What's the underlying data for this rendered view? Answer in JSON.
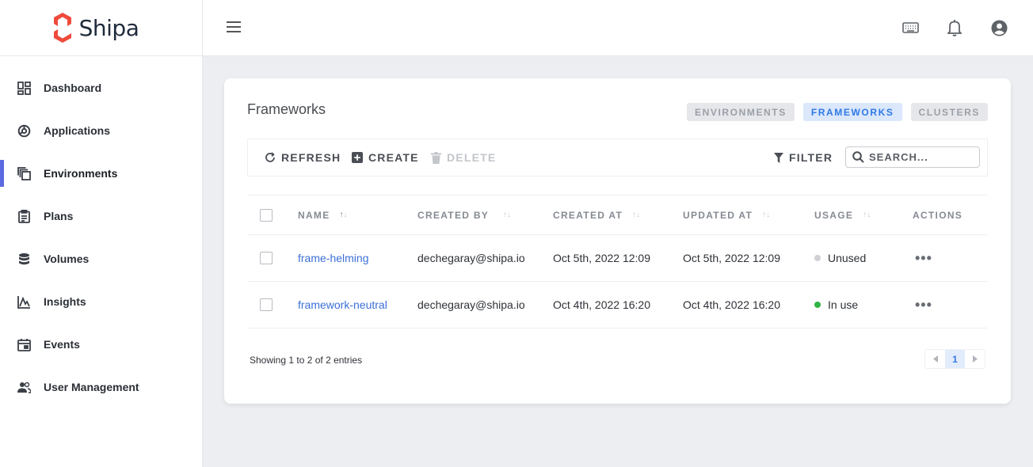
{
  "brand": {
    "name": "Shipa",
    "color": "#ef4a3c"
  },
  "sidebar": {
    "items": [
      {
        "label": "Dashboard",
        "icon": "dashboard-icon"
      },
      {
        "label": "Applications",
        "icon": "applications-icon"
      },
      {
        "label": "Environments",
        "icon": "environments-icon",
        "active": true
      },
      {
        "label": "Plans",
        "icon": "plans-icon"
      },
      {
        "label": "Volumes",
        "icon": "volumes-icon"
      },
      {
        "label": "Insights",
        "icon": "insights-icon"
      },
      {
        "label": "Events",
        "icon": "events-icon"
      },
      {
        "label": "User Management",
        "icon": "user-management-icon"
      }
    ],
    "accent": "#5b6ae0"
  },
  "header": {
    "icons": [
      "menu-icon",
      "keyboard-icon",
      "bell-icon",
      "account-icon"
    ]
  },
  "main": {
    "title": "Frameworks",
    "tabs": [
      {
        "label": "ENVIRONMENTS",
        "active": false
      },
      {
        "label": "FRAMEWORKS",
        "active": true
      },
      {
        "label": "CLUSTERS",
        "active": false
      }
    ],
    "toolbar": {
      "refresh_label": "REFRESH",
      "create_label": "CREATE",
      "delete_label": "DELETE",
      "filter_label": "FILTER",
      "search_placeholder": "SEARCH..."
    },
    "table": {
      "columns": [
        "NAME",
        "CREATED BY",
        "CREATED AT",
        "UPDATED AT",
        "USAGE",
        "ACTIONS"
      ],
      "rows": [
        {
          "name": "frame-helming",
          "created_by": "dechegaray@shipa.io",
          "created_at": "Oct 5th, 2022 12:09",
          "updated_at": "Oct 5th, 2022 12:09",
          "usage": "Unused",
          "usage_color": "#cfd1d5"
        },
        {
          "name": "framework-neutral",
          "created_by": "dechegaray@shipa.io",
          "created_at": "Oct 4th, 2022 16:20",
          "updated_at": "Oct 4th, 2022 16:20",
          "usage": "In use",
          "usage_color": "#2fb344"
        }
      ]
    },
    "footer": {
      "showing": "Showing 1 to 2 of 2 entries",
      "page": "1"
    }
  }
}
